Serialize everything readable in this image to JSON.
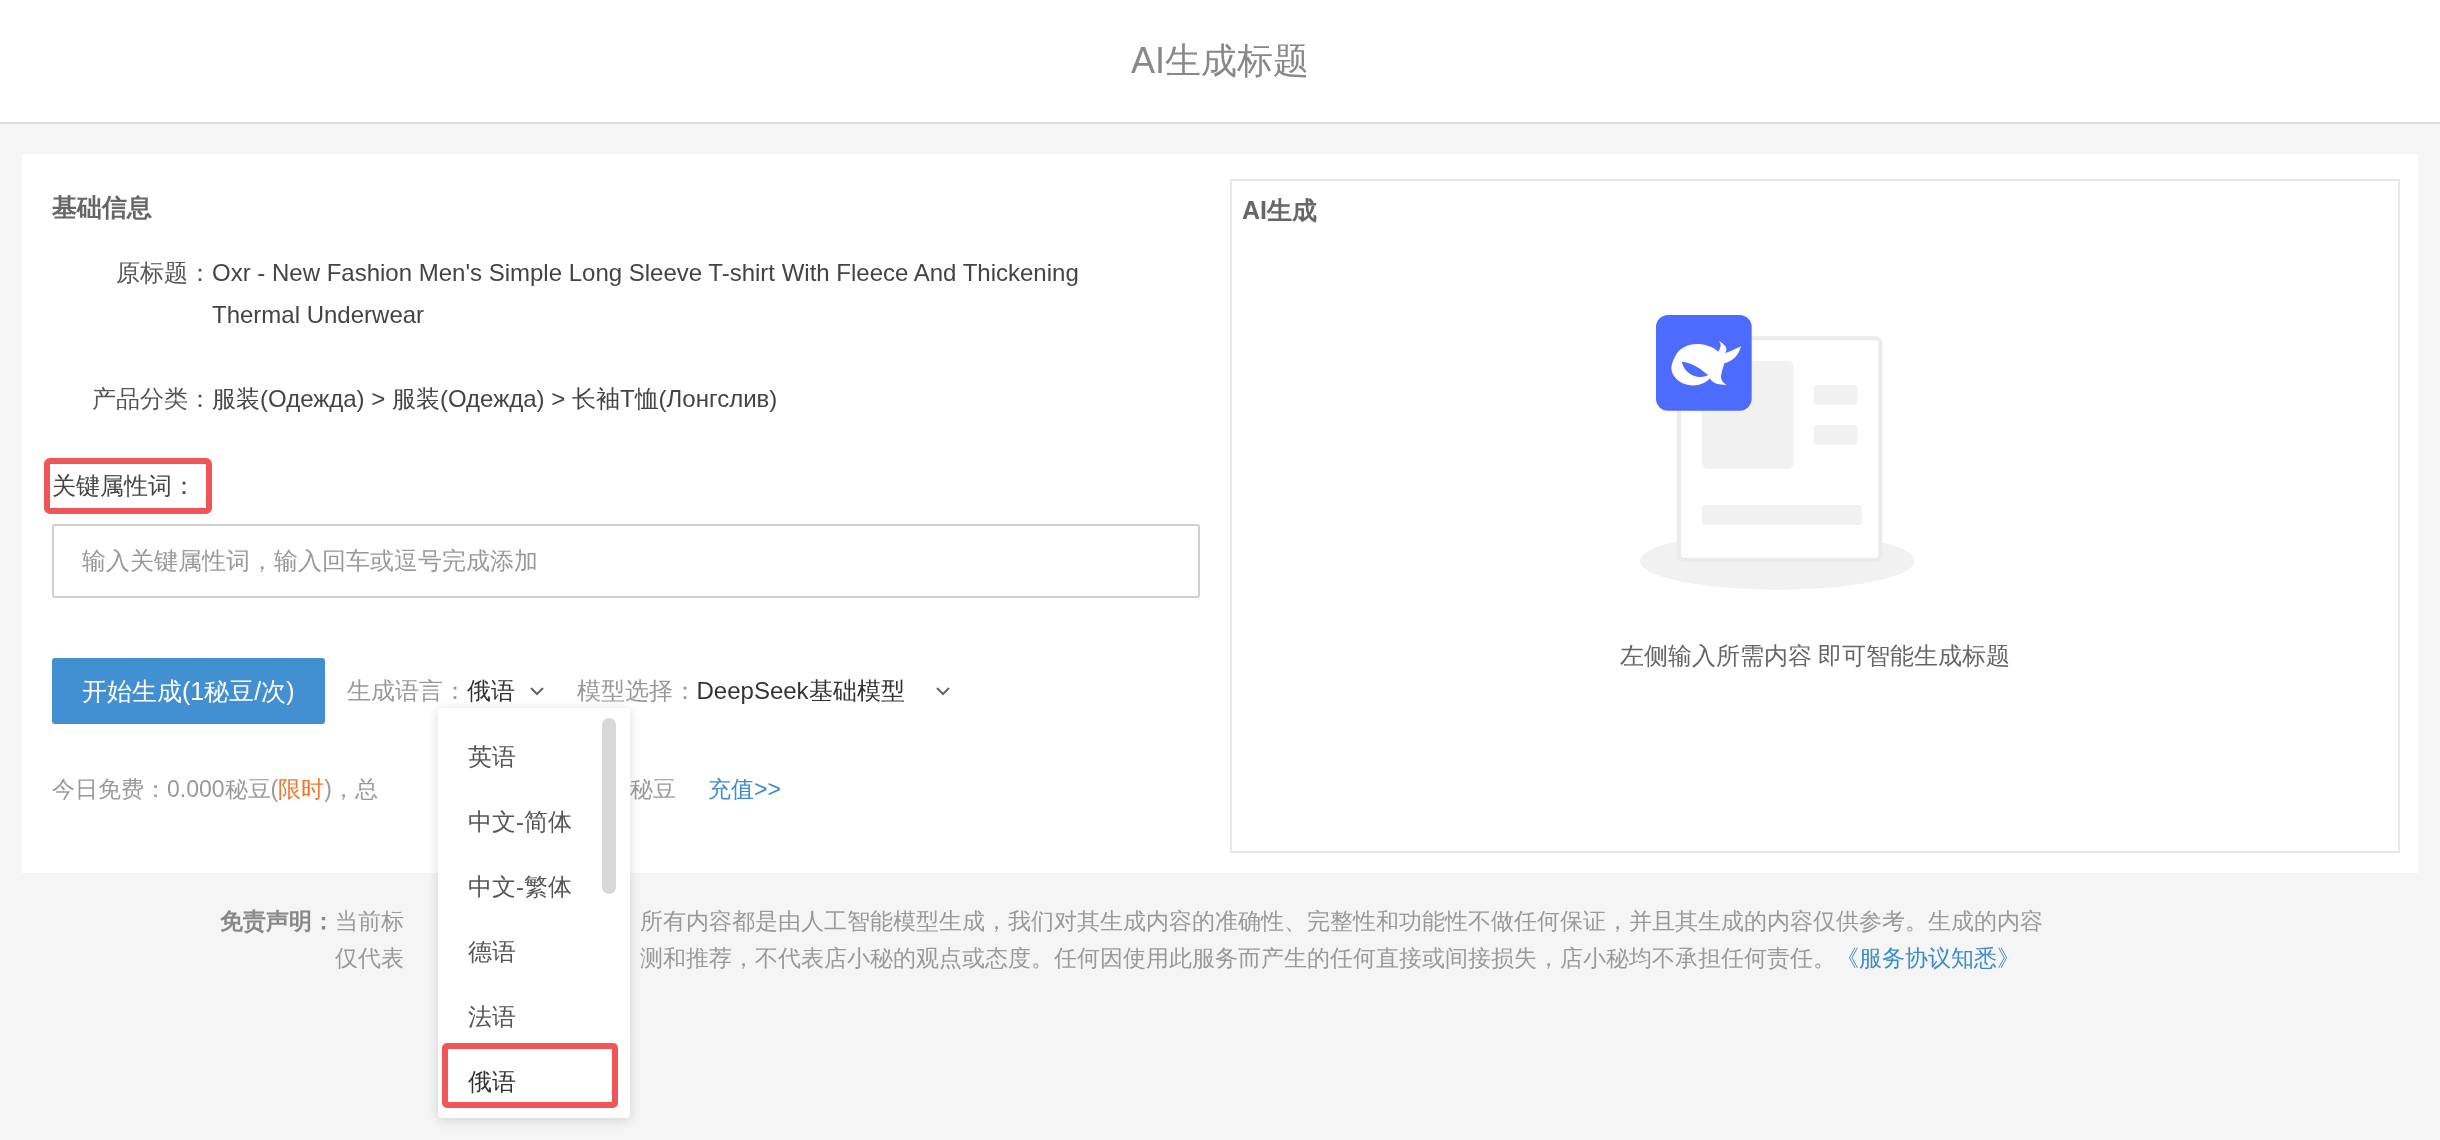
{
  "header": {
    "title": "AI生成标题"
  },
  "basic_info": {
    "heading": "基础信息",
    "fields": [
      {
        "label": "原标题：",
        "value": "Oxr - New Fashion Men's Simple Long Sleeve T-shirt With Fleece And Thickening Thermal Underwear"
      },
      {
        "label": "产品分类：",
        "value": "服装(Одежда) > 服装(Одежда) > 长袖T恤(Лонгслив)"
      }
    ]
  },
  "keywords": {
    "label": "关键属性词：",
    "highlighted": true,
    "placeholder": "输入关键属性词，输入回车或逗号完成添加"
  },
  "generate_button": "开始生成(1秘豆/次)",
  "language_select": {
    "label": "生成语言：",
    "value": "俄语",
    "open": true,
    "options": [
      {
        "label": "英语",
        "selected": false,
        "highlighted": false
      },
      {
        "label": "中文-简体",
        "selected": false,
        "highlighted": false
      },
      {
        "label": "中文-繁体",
        "selected": false,
        "highlighted": false
      },
      {
        "label": "德语",
        "selected": false,
        "highlighted": false
      },
      {
        "label": "法语",
        "selected": false,
        "highlighted": false
      },
      {
        "label": "俄语",
        "selected": true,
        "highlighted": true
      }
    ]
  },
  "model_select": {
    "label": "模型选择：",
    "value": "DeepSeek基础模型"
  },
  "free_info": {
    "before": "今日免费：0.000秘豆(",
    "limited": "限时",
    "middle": ")，总",
    "after": "秘豆",
    "recharge": "充值>>"
  },
  "ai_panel": {
    "heading": "AI生成",
    "empty_text": "左侧输入所需内容 即可智能生成标题"
  },
  "disclaimer": {
    "label": "免责声明：",
    "line1_before": "当前标",
    "line1_after": "所有内容都是由人工智能模型生成，我们对其生成内容的准确性、完整性和功能性不做任何保证，并且其生成的内容仅供参考。生成的内容",
    "line2_before": "仅代表",
    "line2_after": "测和推荐，不代表店小秘的观点或态度。任何因使用此服务而产生的任何直接或间接损失，店小秘均不承担任何责任。",
    "link": "《服务协议知悉》"
  }
}
